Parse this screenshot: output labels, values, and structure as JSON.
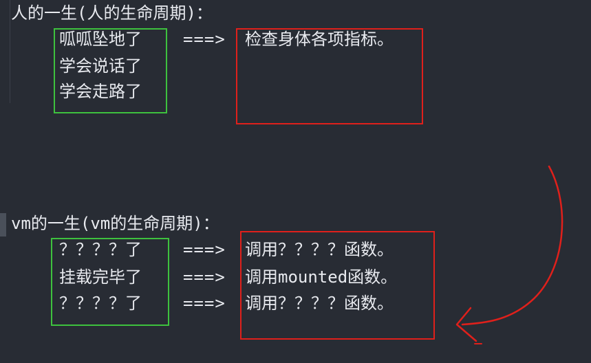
{
  "section1": {
    "title": "人的一生(人的生命周期)：",
    "rows": [
      {
        "left": "呱呱坠地了",
        "arrow": "===>",
        "right": "检查身体各项指标。"
      },
      {
        "left": "学会说话了",
        "arrow": "",
        "right": ""
      },
      {
        "left": "学会走路了",
        "arrow": "",
        "right": ""
      }
    ]
  },
  "section2": {
    "title": "vm的一生(vm的生命周期)：",
    "rows": [
      {
        "left": "？？？？了",
        "arrow": "===>",
        "right": "调用？？？？函数。"
      },
      {
        "left": "挂载完毕了",
        "arrow": "===>",
        "right": "调用mounted函数。"
      },
      {
        "left": "？？？？了",
        "arrow": "===>",
        "right": "调用？？？？函数。"
      }
    ]
  },
  "colors": {
    "background": "#282c34",
    "text": "#e8eaef",
    "green_box": "#3ec23e",
    "red_box": "#e0201b",
    "red_stroke": "#e0201b"
  }
}
